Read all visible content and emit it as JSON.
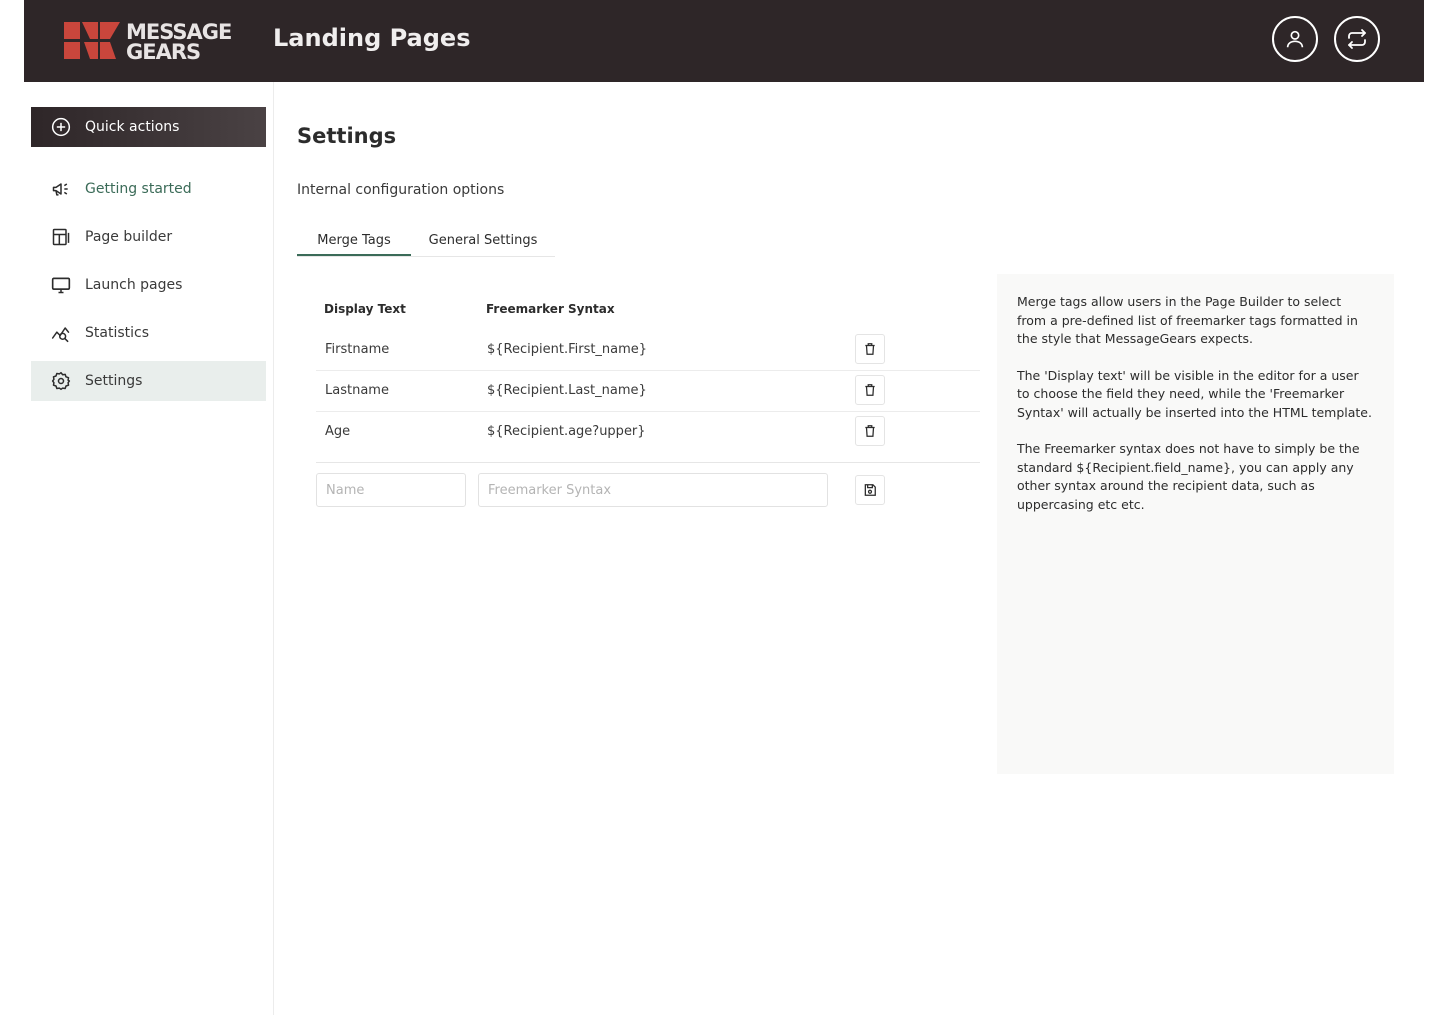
{
  "header": {
    "logo_line1": "MESSAGE",
    "logo_line2": "GEARS",
    "app_title": "Landing Pages",
    "profile_icon": "user-icon",
    "switch_icon": "swap-icon"
  },
  "sidebar": {
    "quick_actions": "Quick actions",
    "items": [
      {
        "label": "Getting started",
        "icon": "megaphone-icon"
      },
      {
        "label": "Page builder",
        "icon": "layout-icon"
      },
      {
        "label": "Launch pages",
        "icon": "monitor-icon"
      },
      {
        "label": "Statistics",
        "icon": "chart-search-icon"
      },
      {
        "label": "Settings",
        "icon": "gear-icon"
      }
    ]
  },
  "main": {
    "title": "Settings",
    "subtitle": "Internal configuration options",
    "tabs": [
      {
        "label": "Merge Tags",
        "active": true
      },
      {
        "label": "General Settings",
        "active": false
      }
    ],
    "table": {
      "headers": [
        "Display Text",
        "Freemarker Syntax"
      ],
      "rows": [
        {
          "display": "Firstname",
          "syntax": "${Recipient.First_name}"
        },
        {
          "display": "Lastname",
          "syntax": "${Recipient.Last_name}"
        },
        {
          "display": "Age",
          "syntax": "${Recipient.age?upper}"
        }
      ]
    },
    "new_row": {
      "name_placeholder": "Name",
      "syntax_placeholder": "Freemarker Syntax"
    },
    "help": [
      "Merge tags allow users in the Page Builder to select from a pre-defined list of freemarker tags formatted in the style that MessageGears expects.",
      "The 'Display text' will be visible in the editor for a user to choose the field they need, while the 'Freemarker Syntax' will actually be inserted into the HTML template.",
      "The Freemarker syntax does not have to simply be the standard ${Recipient.field_name}, you can apply any other syntax around the recipient data, such as uppercasing etc etc."
    ]
  },
  "colors": {
    "header_bg": "#2e2628",
    "accent_green": "#3b6b58",
    "logo_red": "#c9463c",
    "selected_bg": "#e9eeec"
  }
}
